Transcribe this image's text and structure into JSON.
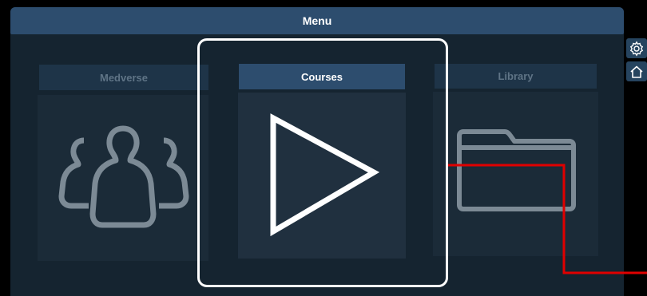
{
  "menu": {
    "title": "Menu"
  },
  "tiles": [
    {
      "label": "Medverse",
      "icon": "people-group-icon",
      "selected": false
    },
    {
      "label": "Courses",
      "icon": "play-icon",
      "selected": true
    },
    {
      "label": "Library",
      "icon": "folder-icon",
      "selected": false
    }
  ],
  "side_buttons": [
    {
      "icon": "gear-icon"
    },
    {
      "icon": "home-icon"
    }
  ],
  "colors": {
    "header": "#2d4d6e",
    "panel": "#152430",
    "selection_frame": "#ffffff",
    "annotation": "#e00000"
  }
}
